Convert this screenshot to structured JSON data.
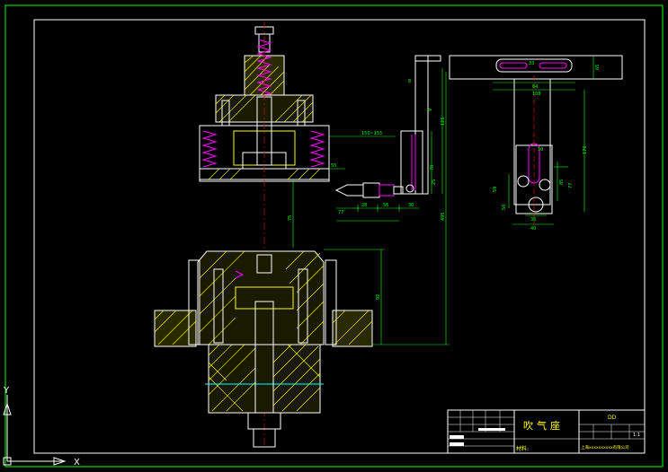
{
  "drawing": {
    "part_name": "吹气座",
    "material_label": "材料:",
    "title_code": "DD",
    "scale": "1:1",
    "company": "上海xxxxxxxxxx有限公司"
  },
  "ucs": {
    "x_label": "X",
    "y_label": "Y"
  },
  "colors": {
    "background": "#000000",
    "outline": "#ffffff",
    "dimension": "#00ff00",
    "section_fill": "#ffff00",
    "center_line": "#ff0000",
    "spring": "#ff00ff",
    "frame": "#00ff00"
  },
  "dimensions": {
    "d_150_155": "150~155",
    "d_55_left": "55",
    "d_77": "77",
    "d_28": "28",
    "d_56": "56",
    "d_30": "30",
    "d_70": "70",
    "d_25": "25",
    "d_8": "8",
    "d_9": "9",
    "d_125": "125",
    "d_75": "75",
    "d_92": "92",
    "d_495": "495",
    "d_33": "33",
    "d_65": "65",
    "d_84": "84",
    "d_108": "108",
    "d_59": "59",
    "d_50": "50",
    "d_85": "85",
    "d_40": "40",
    "d_36": "36",
    "d_10": "10",
    "d_176": "176",
    "d_77b": "77"
  }
}
